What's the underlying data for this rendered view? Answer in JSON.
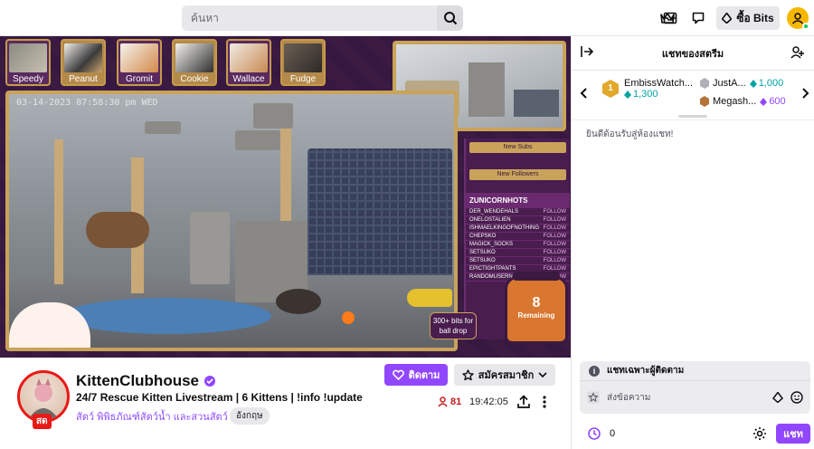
{
  "topbar": {
    "search_placeholder": "ค้นหา",
    "bits_label": "ซื้อ Bits"
  },
  "video": {
    "timestamp": "03-14-2023 07:58:30 pm WED",
    "kittens": [
      {
        "name": "Speedy",
        "active": false
      },
      {
        "name": "Peanut",
        "active": true
      },
      {
        "name": "Gromit",
        "active": false
      },
      {
        "name": "Cookie",
        "active": true
      },
      {
        "name": "Wallace",
        "active": false
      },
      {
        "name": "Fudge",
        "active": true
      }
    ],
    "overlay": {
      "new_subs": "New Subs",
      "new_followers": "New Followers",
      "top_label": "ZUNICORNHOTS",
      "followers": [
        "DER_WENDEHALS",
        "ONELOSTALIEN",
        "ISHMAELKINGOFNOTHING",
        "CHEPSKO",
        "MAGICK_SOCKS",
        "SETSUKO",
        "SETSUKO",
        "EPICTIGHTPANTS",
        "RANDOMUSERNAMEG"
      ],
      "follow_tag": "FOLLOW",
      "ball_drop": "300+ bits for ball drop",
      "jar_count": "8",
      "jar_label": "Remaining"
    }
  },
  "channel": {
    "name": "KittenClubhouse",
    "title": "24/7 Rescue Kitten Livestream | 6 Kittens | !info !update",
    "category": "สัตว์ พิพิธภัณฑ์สัตว์น้ำ และสวนสัตว์",
    "tag": "อังกฤษ",
    "live": "สด",
    "follow": "ติดตาม",
    "subscribe": "สมัครสมาชิก",
    "viewers": "81",
    "uptime": "19:42:05"
  },
  "chat": {
    "title": "แชทของสตรีม",
    "leaderboard": [
      {
        "rank": "1",
        "name": "EmbissWatch...",
        "value": "1,300",
        "color": "#00a3a3"
      },
      {
        "rank": "2",
        "name": "JustA...",
        "value": "1,000",
        "color": "#00a3a3"
      },
      {
        "rank": "3",
        "name": "Megash...",
        "value": "600",
        "color": "#9147ff"
      }
    ],
    "welcome": "ยินดีต้อนรับสู่ห้องแชท!",
    "followers_only": "แชทเฉพาะผู้ติดตาม",
    "input_placeholder": "ส่งข้อความ",
    "points": "0",
    "send": "แชท"
  },
  "colors": {
    "accent": "#9147ff",
    "live": "#e91916",
    "overlay_bg": "#3a1a3f",
    "overlay_gold": "#c9a35a"
  }
}
